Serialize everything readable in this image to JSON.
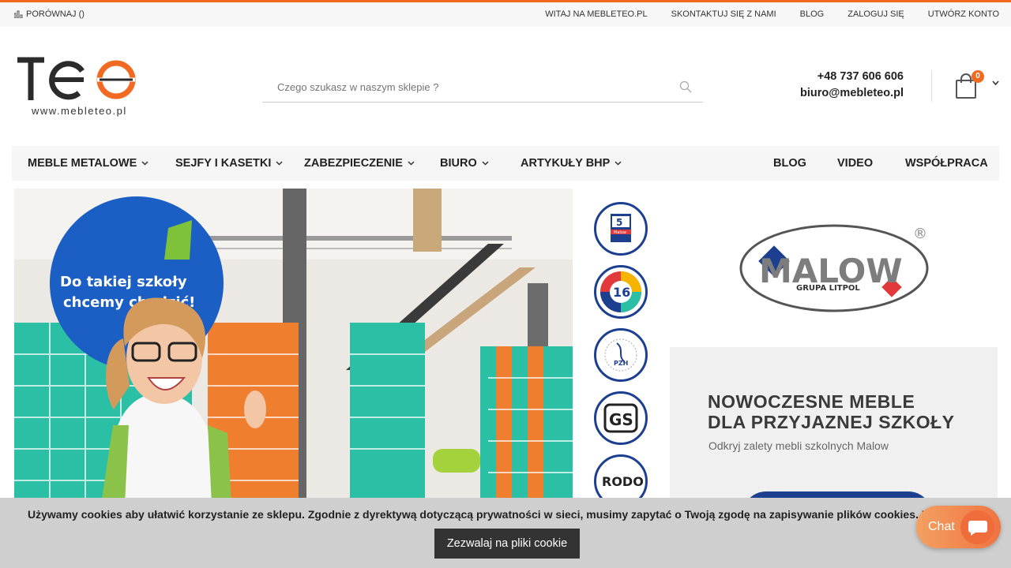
{
  "colors": {
    "accent": "#f26a21",
    "brand_blue": "#1d3f8f",
    "teal": "#2bbfa6",
    "orange": "#f07e2f"
  },
  "topbar": {
    "compare_label": "PORÓWNAJ ()",
    "compare_icon": "bar-chart-icon",
    "links": [
      {
        "label": "WITAJ NA MEBLETEO.PL"
      },
      {
        "label": "SKONTAKTUJ SIĘ Z NAMI"
      },
      {
        "label": "BLOG"
      },
      {
        "label": "ZALOGUJ SIĘ"
      },
      {
        "label": "UTWÓRZ KONTO"
      }
    ]
  },
  "header": {
    "logo_text": "TEO",
    "logo_url_text": "www.mebleteo.pl",
    "search_placeholder": "Czego szukasz w naszym sklepie ?",
    "search_icon": "search-icon",
    "phone": "+48 737 606 606",
    "email": "biuro@mebleteo.pl",
    "cart_icon": "shopping-bag-icon",
    "cart_count": "0"
  },
  "nav": {
    "items": [
      {
        "label": "MEBLE METALOWE"
      },
      {
        "label": "SEJFY I KASETKI"
      },
      {
        "label": "ZABEZPIECZENIE"
      },
      {
        "label": "BIURO"
      },
      {
        "label": "ARTYKUŁY BHP"
      },
      {
        "label": "BLOG"
      },
      {
        "label": "VIDEO"
      },
      {
        "label": "WSPÓŁPRACA"
      }
    ]
  },
  "banner": {
    "headline_line1": "Do takiej szkoły",
    "headline_line2": "chcemy chodzić!"
  },
  "certs": [
    {
      "label": "5",
      "sub": "Malow",
      "name": "warranty-badge"
    },
    {
      "label": "16",
      "name": "colors-badge"
    },
    {
      "label": "PZH",
      "name": "pzh-badge"
    },
    {
      "label": "GS",
      "name": "gs-badge"
    },
    {
      "label": "RODO",
      "name": "rodo-badge"
    }
  ],
  "malow": {
    "brand": "MALOW",
    "tagline": "GRUPA LITPOL",
    "reg": "®"
  },
  "promo": {
    "heading_line1": "NOWOCZESNE MEBLE",
    "heading_line2": "DLA PRZYJAZNEJ SZKOŁY",
    "subheading": "Odkryj zalety mebli szkolnych Malow"
  },
  "cookie": {
    "message": "Używamy cookies aby ułatwić korzystanie ze sklepu. Zgodnie z dyrektywą dotyczącą prywatności w sieci, musimy zapytać o Twoją zgodę na zapisywanie plików cookies. Dowie",
    "accept_label": "Zezwalaj na pliki cookie"
  },
  "chat": {
    "label": "Chat"
  }
}
